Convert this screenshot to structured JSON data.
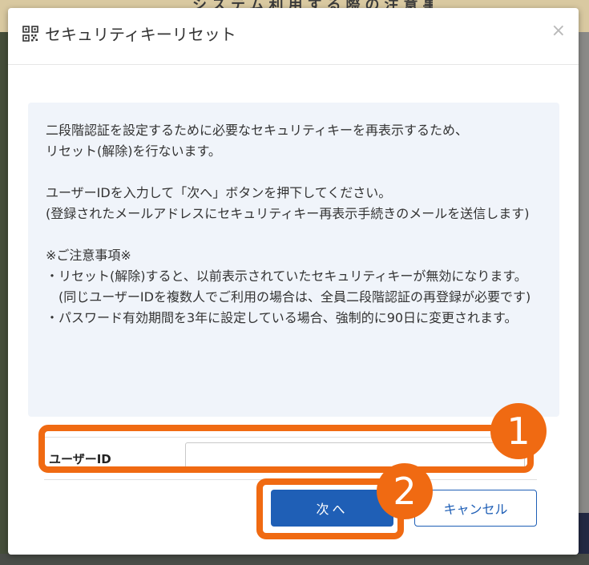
{
  "background": {
    "header_text": "システム利用する際の注意事項"
  },
  "modal": {
    "title": "セキュリティキーリセット",
    "close_symbol": "×",
    "info": {
      "line1": "二段階認証を設定するために必要なセキュリティキーを再表示するため、",
      "line2": "リセット(解除)を行ないます。",
      "line3": "ユーザーIDを入力して「次へ」ボタンを押下してください。",
      "line4": "(登録されたメールアドレスにセキュリティキー再表示手続きのメールを送信します)",
      "notes_title": "※ご注意事項※",
      "note1": "・リセット(解除)すると、以前表示されていたセキュリティキーが無効になります。",
      "note1_sub": "(同じユーザーIDを複数人でご利用の場合は、全員二段階認証の再登録が必要です)",
      "note2": "・パスワード有効期間を3年に設定している場合、強制的に90日に変更されます。"
    },
    "form": {
      "user_id_label": "ユーザーID",
      "user_id_value": "",
      "user_id_placeholder": ""
    },
    "buttons": {
      "next": "次へ",
      "cancel": "キャンセル"
    }
  },
  "annotations": {
    "badge1": "1",
    "badge2": "2",
    "color": "#f06a12"
  },
  "colors": {
    "primary": "#1f5fb6",
    "info_bg": "#f0f4fa"
  },
  "icons": {
    "title_icon": "qr-code-icon",
    "close_icon": "close-icon"
  }
}
